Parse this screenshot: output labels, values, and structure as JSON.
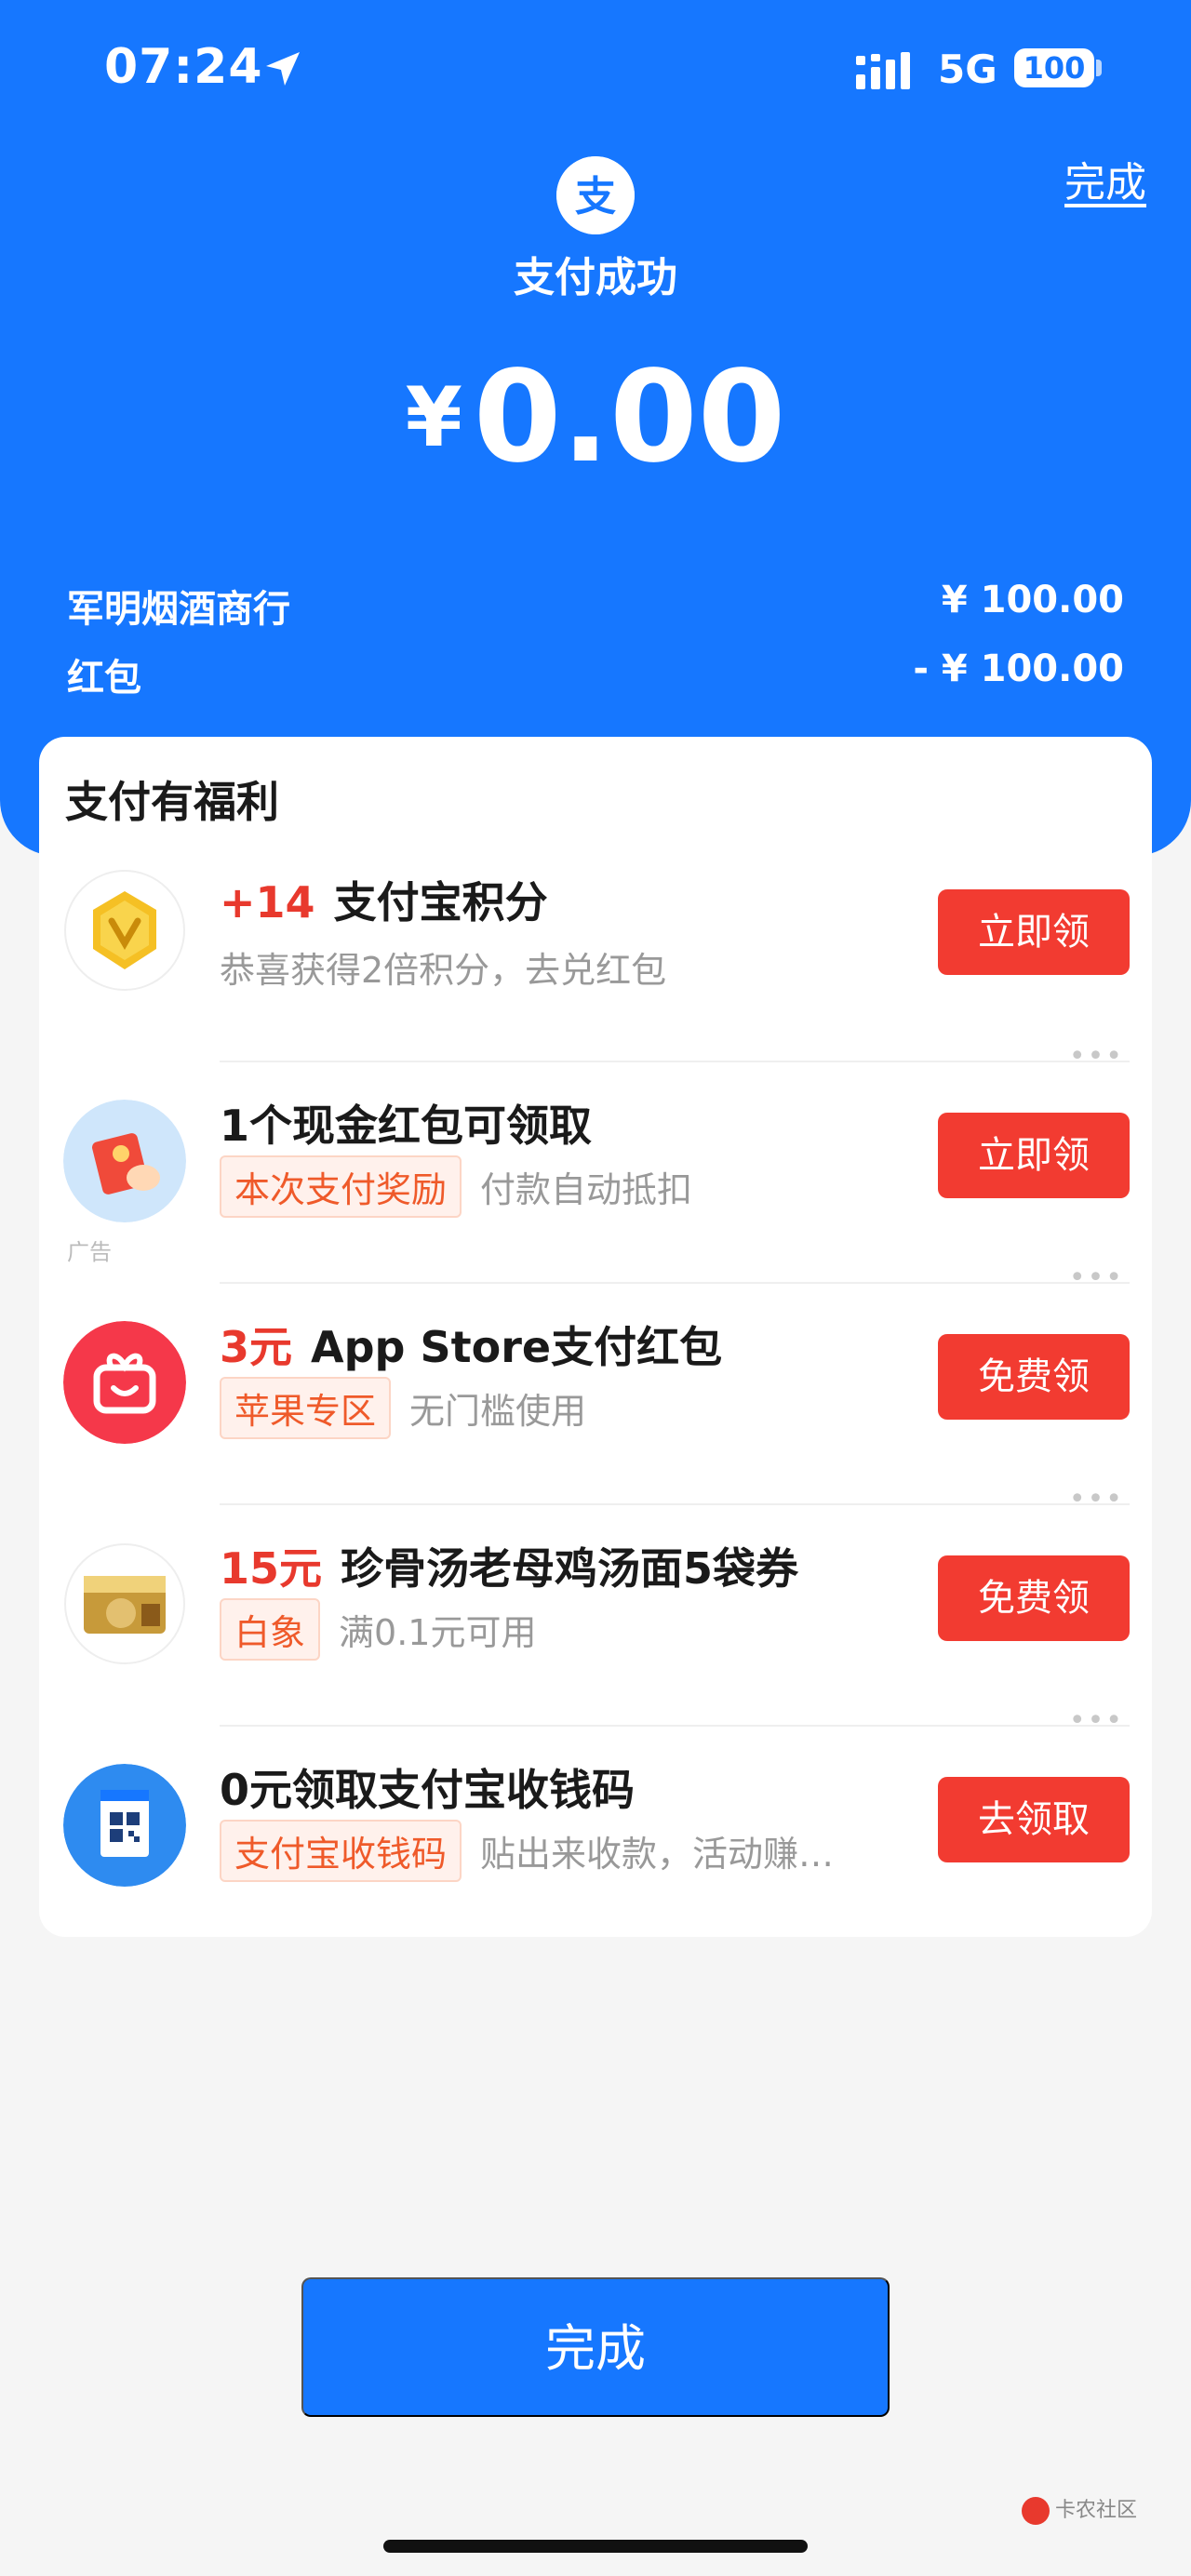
{
  "status": {
    "time": "07:24",
    "network": "5G",
    "battery": "100"
  },
  "header": {
    "done_link": "完成",
    "title": "支付成功",
    "currency": "¥",
    "amount": "0.00"
  },
  "details": [
    {
      "label": "军明烟酒商行",
      "value": "¥ 100.00"
    },
    {
      "label": "红包",
      "value": "- ¥ 100.00"
    }
  ],
  "benefits": {
    "title": "支付有福利",
    "items": [
      {
        "highlight": "+14",
        "title": "支付宝积分",
        "tag": "",
        "desc": "恭喜获得2倍积分，去兑红包",
        "button": "立即领",
        "icon": "gold-coin-icon"
      },
      {
        "highlight": "",
        "title": "1个现金红包可领取",
        "tag": "本次支付奖励",
        "desc": "付款自动抵扣",
        "button": "立即领",
        "icon": "red-envelope-icon",
        "ad": "广告"
      },
      {
        "highlight": "3元",
        "title": "App Store支付红包",
        "tag": "苹果专区",
        "desc": "无门槛使用",
        "button": "免费领",
        "icon": "gift-box-icon"
      },
      {
        "highlight": "15元",
        "title": "珍骨汤老母鸡汤面5袋券",
        "tag": "白象",
        "desc": "满0.1元可用",
        "button": "免费领",
        "icon": "noodle-pack-icon"
      },
      {
        "highlight": "",
        "title": "0元领取支付宝收钱码",
        "tag": "支付宝收钱码",
        "desc": "贴出来收款，活动赚…",
        "button": "去领取",
        "icon": "qr-code-icon"
      }
    ]
  },
  "footer": {
    "done_button": "完成",
    "watermark": "卡农社区"
  },
  "colors": {
    "brand_blue": "#1677ff",
    "accent_red": "#f23b31"
  }
}
